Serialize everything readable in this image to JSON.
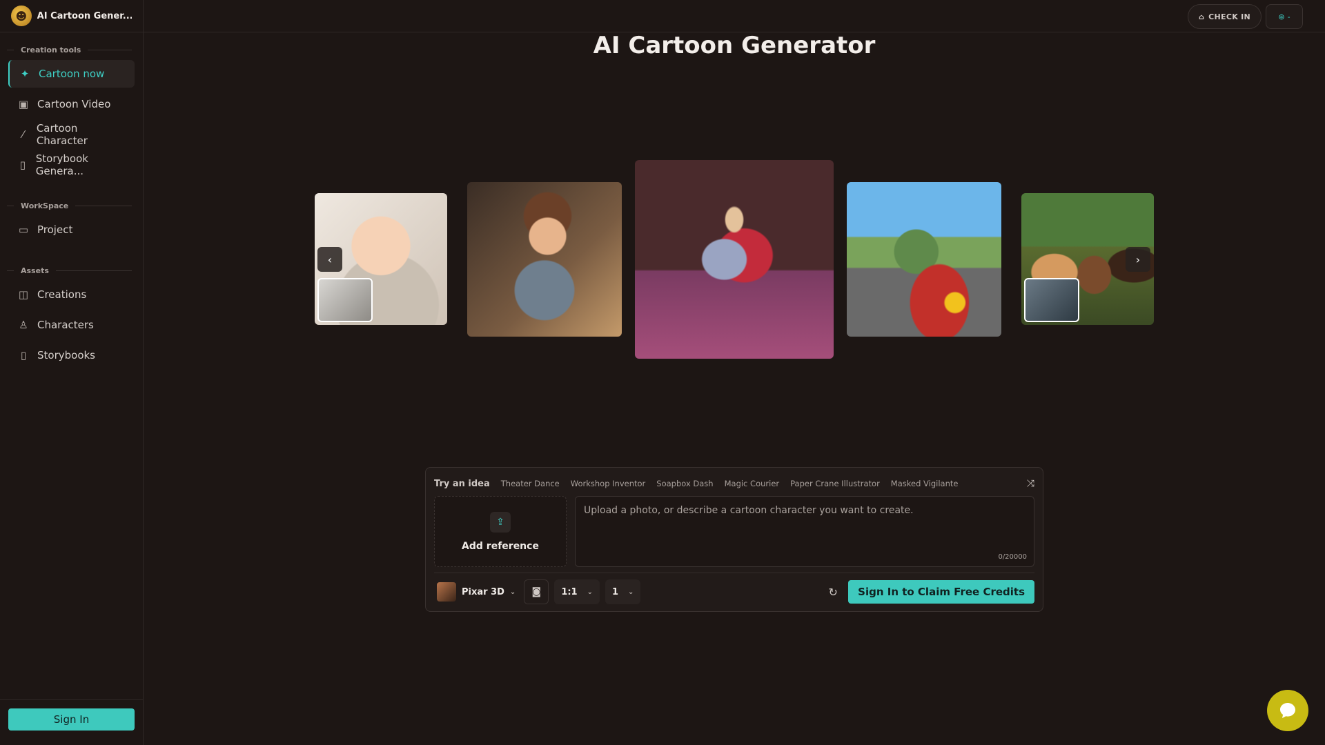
{
  "app": {
    "name": "AI Cartoon Gener..."
  },
  "sidebar": {
    "sections": [
      {
        "label": "Creation tools"
      },
      {
        "label": "WorkSpace"
      },
      {
        "label": "Assets"
      }
    ],
    "creation_items": [
      {
        "label": "Cartoon now",
        "icon": "sparkle-icon",
        "active": true
      },
      {
        "label": "Cartoon Video",
        "icon": "video-icon"
      },
      {
        "label": "Cartoon Character",
        "icon": "wand-icon"
      },
      {
        "label": "Storybook Genera...",
        "icon": "book-icon"
      }
    ],
    "workspace_items": [
      {
        "label": "Project",
        "icon": "folder-icon"
      }
    ],
    "asset_items": [
      {
        "label": "Creations",
        "icon": "gallery-icon"
      },
      {
        "label": "Characters",
        "icon": "user-icon"
      },
      {
        "label": "Storybooks",
        "icon": "book-icon"
      }
    ],
    "sign_in_label": "Sign In"
  },
  "topbar": {
    "check_in_label": "CHECK IN",
    "lang_label": "-"
  },
  "main": {
    "title": "AI Cartoon Generator"
  },
  "carousel": {
    "items": [
      "baby-portrait",
      "workshop-boy",
      "dancing-prince",
      "soapbox-race",
      "friends-group"
    ],
    "prev_icon": "chevron-left-icon",
    "next_icon": "chevron-right-icon"
  },
  "prompt_panel": {
    "try_label": "Try an idea",
    "ideas": [
      "Theater Dance",
      "Workshop Inventor",
      "Soapbox Dash",
      "Magic Courier",
      "Paper Crane Illustrator",
      "Masked Vigilante"
    ],
    "add_reference_label": "Add reference",
    "placeholder": "Upload a photo, or describe a cartoon character you want to create.",
    "value": "",
    "counter": "0/20000",
    "style_label": "Pixar 3D",
    "ratio_label": "1:1",
    "count_label": "1",
    "claim_label": "Sign In to Claim Free Credits"
  },
  "colors": {
    "accent": "#3ec9bd",
    "background": "#1d1614",
    "chat": "#c8bb13"
  }
}
